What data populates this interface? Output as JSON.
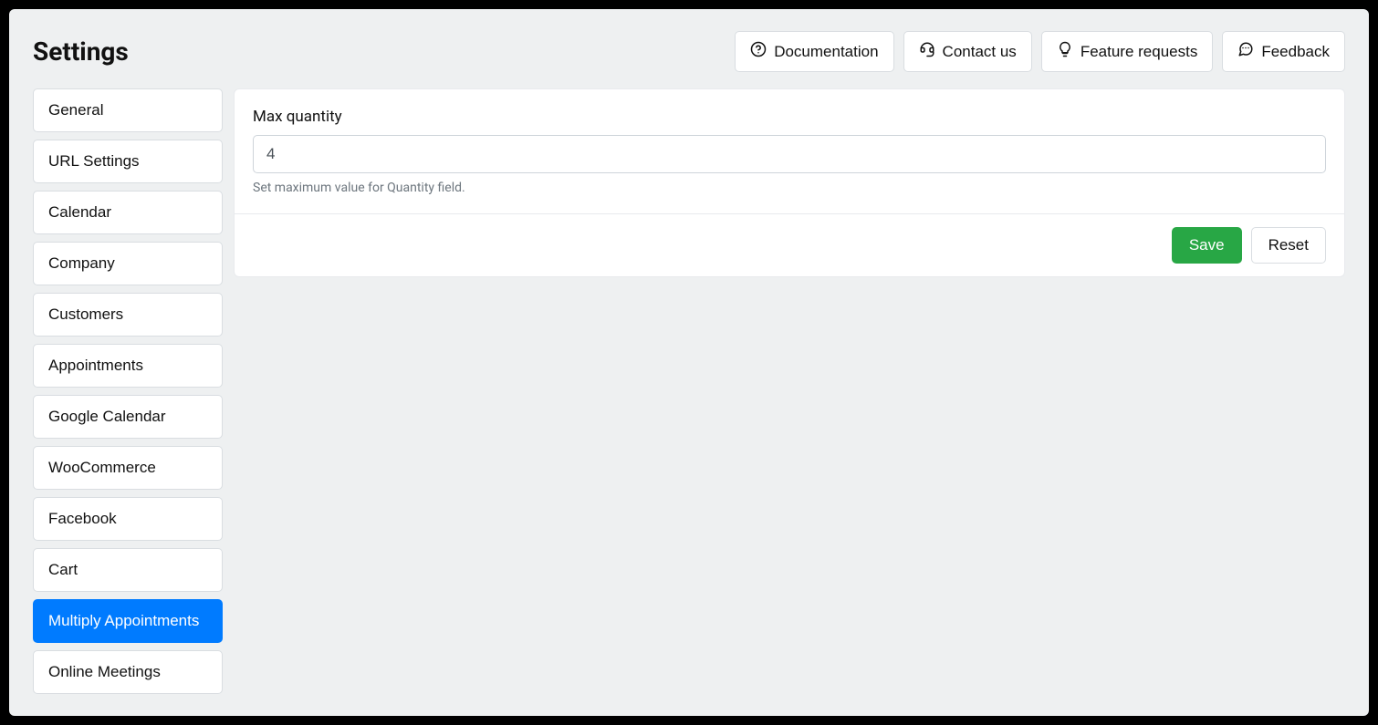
{
  "page_title": "Settings",
  "header_buttons": {
    "documentation": "Documentation",
    "contact_us": "Contact us",
    "feature_requests": "Feature requests",
    "feedback": "Feedback"
  },
  "sidebar": {
    "items": [
      {
        "label": "General",
        "active": false
      },
      {
        "label": "URL Settings",
        "active": false
      },
      {
        "label": "Calendar",
        "active": false
      },
      {
        "label": "Company",
        "active": false
      },
      {
        "label": "Customers",
        "active": false
      },
      {
        "label": "Appointments",
        "active": false
      },
      {
        "label": "Google Calendar",
        "active": false
      },
      {
        "label": "WooCommerce",
        "active": false
      },
      {
        "label": "Facebook",
        "active": false
      },
      {
        "label": "Cart",
        "active": false
      },
      {
        "label": "Multiply Appointments",
        "active": true
      },
      {
        "label": "Online Meetings",
        "active": false
      }
    ]
  },
  "form": {
    "max_quantity": {
      "label": "Max quantity",
      "value": "4",
      "help": "Set maximum value for Quantity field."
    }
  },
  "actions": {
    "save": "Save",
    "reset": "Reset"
  }
}
